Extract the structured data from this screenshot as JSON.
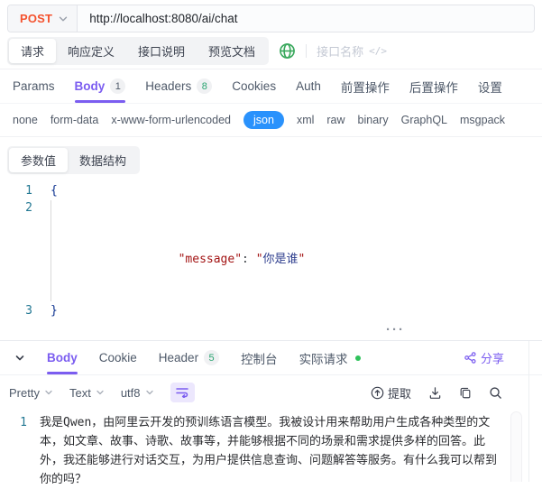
{
  "colors": {
    "method_orange": "#f4522e",
    "accent_purple": "#7b5df0",
    "json_pill_blue": "#2a92fc",
    "badge_green": "#2ba471",
    "status_dot_green": "#2fc25b",
    "globe_green": "#39a85c",
    "line_number_teal": "#237893",
    "string_red": "#a31515",
    "brace_navy": "#0b318f"
  },
  "request_bar": {
    "method": "POST",
    "url": "http://localhost:8080/ai/chat"
  },
  "doc_tabs": {
    "items": [
      {
        "label": "请求"
      },
      {
        "label": "响应定义"
      },
      {
        "label": "接口说明"
      },
      {
        "label": "预览文档"
      }
    ],
    "active": "请求",
    "api_name_placeholder": "接口名称",
    "code_hint": "</>"
  },
  "request_tabs": {
    "items": [
      {
        "label": "Params"
      },
      {
        "label": "Body",
        "badge": "1"
      },
      {
        "label": "Headers",
        "badge": "8"
      },
      {
        "label": "Cookies"
      },
      {
        "label": "Auth"
      },
      {
        "label": "前置操作"
      },
      {
        "label": "后置操作"
      },
      {
        "label": "设置"
      }
    ],
    "active": "Body"
  },
  "body_types": {
    "items": [
      "none",
      "form-data",
      "x-www-form-urlencoded",
      "json",
      "xml",
      "raw",
      "binary",
      "GraphQL",
      "msgpack"
    ],
    "active": "json"
  },
  "body_editor": {
    "tabs": [
      "参数值",
      "数据结构"
    ],
    "active_tab": "参数值",
    "line_numbers": [
      "1",
      "2",
      "3"
    ],
    "code": {
      "open_brace": "{",
      "key": "\"message\"",
      "separator": ": ",
      "value_open": "\"",
      "value": "你是谁",
      "value_close": "\"",
      "close_brace": "}"
    }
  },
  "ui": {
    "drag_handle": "···"
  },
  "response_panel": {
    "tabs": [
      {
        "label": "Body"
      },
      {
        "label": "Cookie"
      },
      {
        "label": "Header",
        "badge": "5"
      },
      {
        "label": "控制台"
      },
      {
        "label": "实际请求",
        "has_status_dot": true
      }
    ],
    "active": "Body",
    "share_label": "分享",
    "toolbar": {
      "format": "Pretty",
      "view": "Text",
      "encoding": "utf8",
      "extract_label": "提取"
    },
    "body": {
      "line_number": "1",
      "text": "我是Qwen，由阿里云开发的预训练语言模型。我被设计用来帮助用户生成各种类型的文本，如文章、故事、诗歌、故事等，并能够根据不同的场景和需求提供多样的回答。此外，我还能够进行对话交互，为用户提供信息查询、问题解答等服务。有什么我可以帮到你的吗？"
    }
  }
}
